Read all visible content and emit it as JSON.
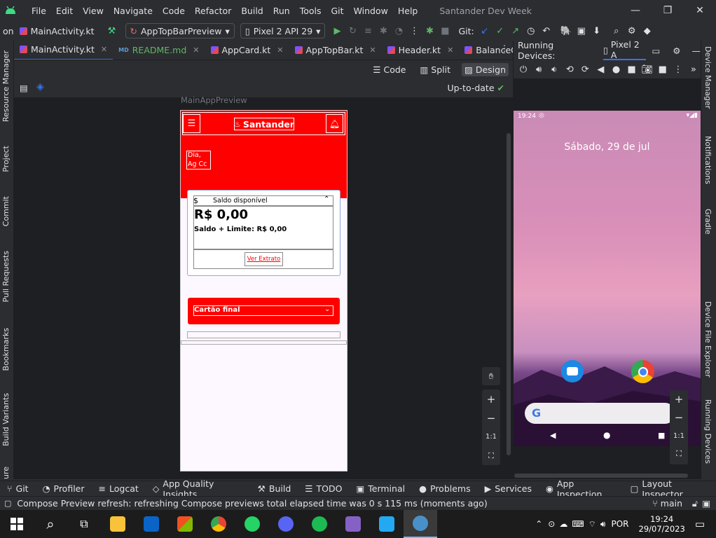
{
  "window": {
    "project_name": "Santander Dev Week",
    "menu": [
      "File",
      "Edit",
      "View",
      "Navigate",
      "Code",
      "Refactor",
      "Build",
      "Run",
      "Tools",
      "Git",
      "Window",
      "Help"
    ],
    "controls": {
      "minimize": "—",
      "maximize": "❐",
      "close": "✕"
    }
  },
  "toolbar": {
    "project_crumb": "on",
    "file_crumb": "MainActivity.kt",
    "run_config": "AppTopBarPreview",
    "device": "Pixel 2 API 29",
    "git_label": "Git:"
  },
  "tabs": [
    {
      "label": "MainActivity.kt",
      "type": "kt",
      "active": true
    },
    {
      "label": "README.md",
      "type": "md",
      "active": false
    },
    {
      "label": "AppCard.kt",
      "type": "kt",
      "active": false
    },
    {
      "label": "AppTopBar.kt",
      "type": "kt",
      "active": false
    },
    {
      "label": "Header.kt",
      "type": "kt",
      "active": false
    },
    {
      "label": "BalanceC",
      "type": "kt",
      "active": false
    }
  ],
  "design_modes": {
    "code": "Code",
    "split": "Split",
    "design": "Design",
    "selected": "Design"
  },
  "preview_status": "Up-to-date",
  "preview": {
    "name": "MainAppPreview",
    "brand": "Santander",
    "header_line1": "Dia,",
    "header_line2": "Ag  Cc",
    "saldo_label": "Saldo disponível",
    "saldo_value": "R$ 0,00",
    "saldo_limite": "Saldo + Limite: R$ 0,00",
    "extrato_button": "Ver Extrato",
    "cartao_label": "Cartão final"
  },
  "zoom_controls": {
    "plus": "+",
    "minus": "−",
    "reset": "1:1"
  },
  "running_devices": {
    "title": "Running Devices:",
    "device_tab": "Pixel 2 A",
    "clock": "19:24",
    "date": "Sábado, 29 de jul"
  },
  "left_tool_windows": [
    "Resource Manager",
    "Project",
    "Commit",
    "Pull Requests",
    "Bookmarks",
    "Build Variants",
    "ure"
  ],
  "right_tool_windows": [
    "Device Manager",
    "Notifications",
    "Gradle",
    "Device File Explorer",
    "Running Devices"
  ],
  "bottom_tools": [
    "Git",
    "Profiler",
    "Logcat",
    "App Quality Insights",
    "Build",
    "TODO",
    "Terminal",
    "Problems",
    "Services",
    "App Inspection",
    "Layout Inspector"
  ],
  "status": {
    "message": "Compose Preview refresh: refreshing Compose previews total elapsed time was 0 s 115 ms (moments ago)",
    "branch": "main"
  },
  "taskbar": {
    "language": "POR",
    "time": "19:24",
    "date": "29/07/2023"
  },
  "colors": {
    "santander_red": "#ff0000",
    "accent": "#3574f0",
    "android_green": "#3ddc84"
  }
}
